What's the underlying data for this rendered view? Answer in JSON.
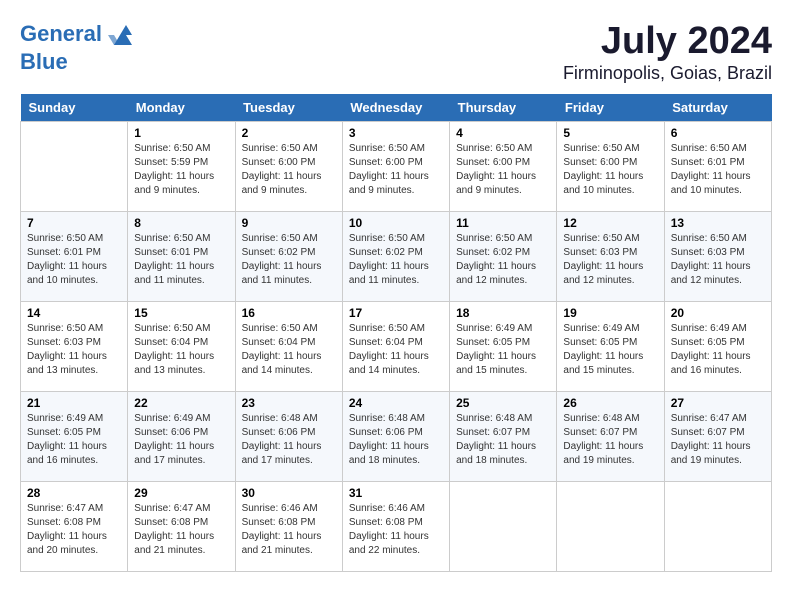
{
  "header": {
    "logo_line1": "General",
    "logo_line2": "Blue",
    "main_title": "July 2024",
    "subtitle": "Firminopolis, Goias, Brazil"
  },
  "calendar": {
    "days_of_week": [
      "Sunday",
      "Monday",
      "Tuesday",
      "Wednesday",
      "Thursday",
      "Friday",
      "Saturday"
    ],
    "weeks": [
      [
        {
          "day": "",
          "info": ""
        },
        {
          "day": "1",
          "info": "Sunrise: 6:50 AM\nSunset: 5:59 PM\nDaylight: 11 hours\nand 9 minutes."
        },
        {
          "day": "2",
          "info": "Sunrise: 6:50 AM\nSunset: 6:00 PM\nDaylight: 11 hours\nand 9 minutes."
        },
        {
          "day": "3",
          "info": "Sunrise: 6:50 AM\nSunset: 6:00 PM\nDaylight: 11 hours\nand 9 minutes."
        },
        {
          "day": "4",
          "info": "Sunrise: 6:50 AM\nSunset: 6:00 PM\nDaylight: 11 hours\nand 9 minutes."
        },
        {
          "day": "5",
          "info": "Sunrise: 6:50 AM\nSunset: 6:00 PM\nDaylight: 11 hours\nand 10 minutes."
        },
        {
          "day": "6",
          "info": "Sunrise: 6:50 AM\nSunset: 6:01 PM\nDaylight: 11 hours\nand 10 minutes."
        }
      ],
      [
        {
          "day": "7",
          "info": "Sunrise: 6:50 AM\nSunset: 6:01 PM\nDaylight: 11 hours\nand 10 minutes."
        },
        {
          "day": "8",
          "info": "Sunrise: 6:50 AM\nSunset: 6:01 PM\nDaylight: 11 hours\nand 11 minutes."
        },
        {
          "day": "9",
          "info": "Sunrise: 6:50 AM\nSunset: 6:02 PM\nDaylight: 11 hours\nand 11 minutes."
        },
        {
          "day": "10",
          "info": "Sunrise: 6:50 AM\nSunset: 6:02 PM\nDaylight: 11 hours\nand 11 minutes."
        },
        {
          "day": "11",
          "info": "Sunrise: 6:50 AM\nSunset: 6:02 PM\nDaylight: 11 hours\nand 12 minutes."
        },
        {
          "day": "12",
          "info": "Sunrise: 6:50 AM\nSunset: 6:03 PM\nDaylight: 11 hours\nand 12 minutes."
        },
        {
          "day": "13",
          "info": "Sunrise: 6:50 AM\nSunset: 6:03 PM\nDaylight: 11 hours\nand 12 minutes."
        }
      ],
      [
        {
          "day": "14",
          "info": "Sunrise: 6:50 AM\nSunset: 6:03 PM\nDaylight: 11 hours\nand 13 minutes."
        },
        {
          "day": "15",
          "info": "Sunrise: 6:50 AM\nSunset: 6:04 PM\nDaylight: 11 hours\nand 13 minutes."
        },
        {
          "day": "16",
          "info": "Sunrise: 6:50 AM\nSunset: 6:04 PM\nDaylight: 11 hours\nand 14 minutes."
        },
        {
          "day": "17",
          "info": "Sunrise: 6:50 AM\nSunset: 6:04 PM\nDaylight: 11 hours\nand 14 minutes."
        },
        {
          "day": "18",
          "info": "Sunrise: 6:49 AM\nSunset: 6:05 PM\nDaylight: 11 hours\nand 15 minutes."
        },
        {
          "day": "19",
          "info": "Sunrise: 6:49 AM\nSunset: 6:05 PM\nDaylight: 11 hours\nand 15 minutes."
        },
        {
          "day": "20",
          "info": "Sunrise: 6:49 AM\nSunset: 6:05 PM\nDaylight: 11 hours\nand 16 minutes."
        }
      ],
      [
        {
          "day": "21",
          "info": "Sunrise: 6:49 AM\nSunset: 6:05 PM\nDaylight: 11 hours\nand 16 minutes."
        },
        {
          "day": "22",
          "info": "Sunrise: 6:49 AM\nSunset: 6:06 PM\nDaylight: 11 hours\nand 17 minutes."
        },
        {
          "day": "23",
          "info": "Sunrise: 6:48 AM\nSunset: 6:06 PM\nDaylight: 11 hours\nand 17 minutes."
        },
        {
          "day": "24",
          "info": "Sunrise: 6:48 AM\nSunset: 6:06 PM\nDaylight: 11 hours\nand 18 minutes."
        },
        {
          "day": "25",
          "info": "Sunrise: 6:48 AM\nSunset: 6:07 PM\nDaylight: 11 hours\nand 18 minutes."
        },
        {
          "day": "26",
          "info": "Sunrise: 6:48 AM\nSunset: 6:07 PM\nDaylight: 11 hours\nand 19 minutes."
        },
        {
          "day": "27",
          "info": "Sunrise: 6:47 AM\nSunset: 6:07 PM\nDaylight: 11 hours\nand 19 minutes."
        }
      ],
      [
        {
          "day": "28",
          "info": "Sunrise: 6:47 AM\nSunset: 6:08 PM\nDaylight: 11 hours\nand 20 minutes."
        },
        {
          "day": "29",
          "info": "Sunrise: 6:47 AM\nSunset: 6:08 PM\nDaylight: 11 hours\nand 21 minutes."
        },
        {
          "day": "30",
          "info": "Sunrise: 6:46 AM\nSunset: 6:08 PM\nDaylight: 11 hours\nand 21 minutes."
        },
        {
          "day": "31",
          "info": "Sunrise: 6:46 AM\nSunset: 6:08 PM\nDaylight: 11 hours\nand 22 minutes."
        },
        {
          "day": "",
          "info": ""
        },
        {
          "day": "",
          "info": ""
        },
        {
          "day": "",
          "info": ""
        }
      ]
    ]
  }
}
